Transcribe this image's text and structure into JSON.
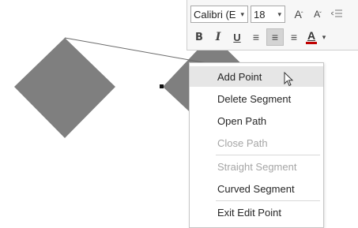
{
  "toolbar": {
    "font_name": "Calibri (E",
    "font_size": "18",
    "dropdown_arrow": "▾",
    "increase_font": "A",
    "decrease_font": "A",
    "increase_sup": "ˆ",
    "decrease_sup": "ˇ",
    "bold": "B",
    "italic": "I",
    "underline": "U",
    "align_left": "≡",
    "align_center": "≡",
    "align_right": "≡",
    "font_color_letter": "A",
    "font_color": "#c00000",
    "font_color_arrow": "▾"
  },
  "context_menu": {
    "items": [
      {
        "label": "Add Point",
        "state": "hover"
      },
      {
        "label": "Delete Segment",
        "state": "enabled"
      },
      {
        "label": "Open Path",
        "state": "enabled"
      },
      {
        "label": "Close Path",
        "state": "disabled"
      },
      {
        "label": "Straight Segment",
        "state": "disabled"
      },
      {
        "label": "Curved Segment",
        "state": "enabled"
      },
      {
        "label": "Exit Edit Point",
        "state": "enabled"
      }
    ]
  },
  "shapes": {
    "fill_color": "#7f7f7f",
    "connector_color": "#6a6a6a",
    "handle_color": "#111111"
  }
}
